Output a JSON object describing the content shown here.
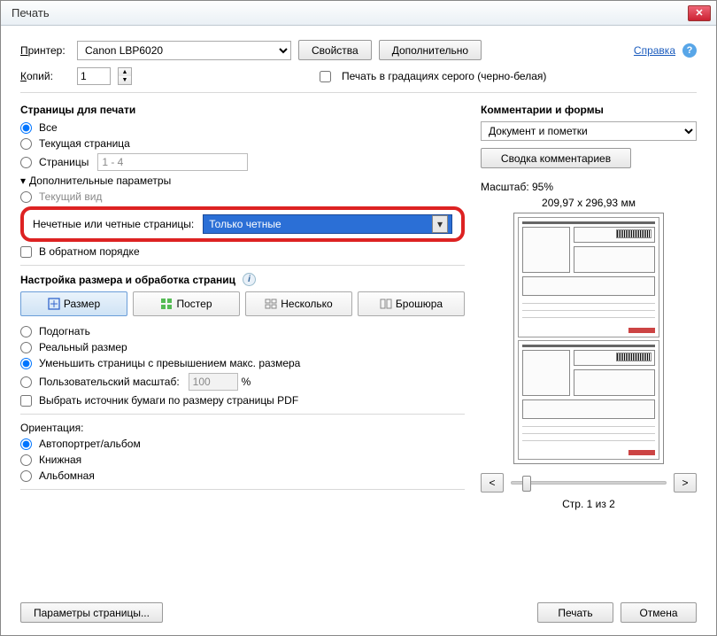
{
  "window": {
    "title": "Печать"
  },
  "help_link": "Справка",
  "printer": {
    "label": "Принтер:",
    "value": "Canon LBP6020",
    "properties_btn": "Свойства",
    "advanced_btn": "Дополнительно"
  },
  "copies": {
    "label": "Копий:",
    "value": "1"
  },
  "grayscale": {
    "label": "Печать в градациях серого (черно-белая)"
  },
  "pages": {
    "title": "Страницы для печати",
    "all": "Все",
    "current": "Текущая страница",
    "range_label": "Страницы",
    "range_value": "1 - 4",
    "more_params": "Дополнительные параметры",
    "current_view": "Текущий вид",
    "odd_even_label": "Нечетные или четные страницы:",
    "odd_even_value": "Только четные",
    "reverse": "В обратном порядке"
  },
  "sizing": {
    "title": "Настройка размера и обработка страниц",
    "tabs": {
      "size": "Размер",
      "poster": "Постер",
      "multiple": "Несколько",
      "booklet": "Брошюра"
    },
    "fit": "Подогнать",
    "actual": "Реальный размер",
    "shrink": "Уменьшить страницы с превышением макс. размера",
    "custom": "Пользовательский масштаб:",
    "custom_value": "100",
    "percent": "%",
    "choose_source": "Выбрать источник бумаги по размеру страницы PDF"
  },
  "orientation": {
    "title": "Ориентация:",
    "auto": "Автопортрет/альбом",
    "portrait": "Книжная",
    "landscape": "Альбомная"
  },
  "comments": {
    "title": "Комментарии и формы",
    "value": "Документ и пометки",
    "summary_btn": "Сводка комментариев"
  },
  "preview": {
    "scale_label": "Масштаб:  95%",
    "dimensions": "209,97 x 296,93 мм",
    "page_info": "Стр. 1 из 2",
    "prev": "<",
    "next": ">"
  },
  "footer": {
    "page_setup": "Параметры страницы...",
    "print": "Печать",
    "cancel": "Отмена"
  }
}
